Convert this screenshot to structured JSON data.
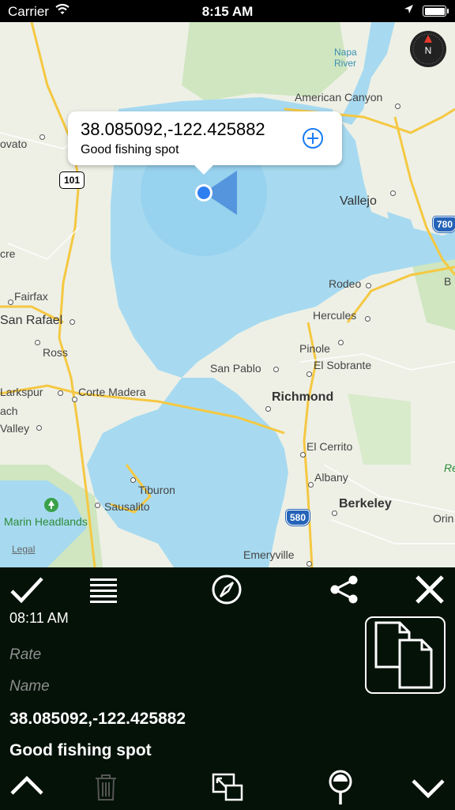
{
  "status_bar": {
    "carrier": "Carrier",
    "time": "8:15 AM"
  },
  "map": {
    "labels": {
      "napa_river": "Napa\nRiver",
      "american_canyon": "American Canyon",
      "vallejo": "Vallejo",
      "novato": "ovato",
      "crest": "cre",
      "fairfax": "Fairfax",
      "san_rafael": "San Rafael",
      "ross": "Ross",
      "rodeo": "Rodeo",
      "hercules": "Hercules",
      "pinole": "Pinole",
      "el_sobrante": "El Sobrante",
      "san_pablo": "San Pablo",
      "richmond": "Richmond",
      "larkspur": "Larkspur",
      "corte_madera": "Corte Madera",
      "ach": "ach",
      "valley": "Valley",
      "el_cerrito": "El Cerrito",
      "albany": "Albany",
      "tiburon": "Tiburon",
      "sausalito": "Sausalito",
      "berkeley": "Berkeley",
      "marin_headlands": "Marin Headlands",
      "emeryville": "Emeryville",
      "orin": "Orin",
      "b_edge": "B",
      "r_edge": "Re"
    },
    "shields": {
      "us101": "101",
      "i780": "780",
      "i580": "580"
    },
    "legal": "Legal"
  },
  "callout": {
    "coordinates": "38.085092,-122.425882",
    "note": "Good fishing spot"
  },
  "panel": {
    "time": "08:11 AM",
    "rate_placeholder": "Rate",
    "name_placeholder": "Name",
    "coordinates": "38.085092,-122.425882",
    "description": "Good fishing spot"
  },
  "icons": {
    "top_toolbar": [
      "checkmark-icon",
      "list-icon",
      "compass-icon",
      "share-icon",
      "close-icon"
    ],
    "bottom_toolbar": [
      "chevron-up-icon",
      "trash-icon",
      "resize-icon",
      "pin-icon",
      "chevron-down-icon"
    ]
  }
}
